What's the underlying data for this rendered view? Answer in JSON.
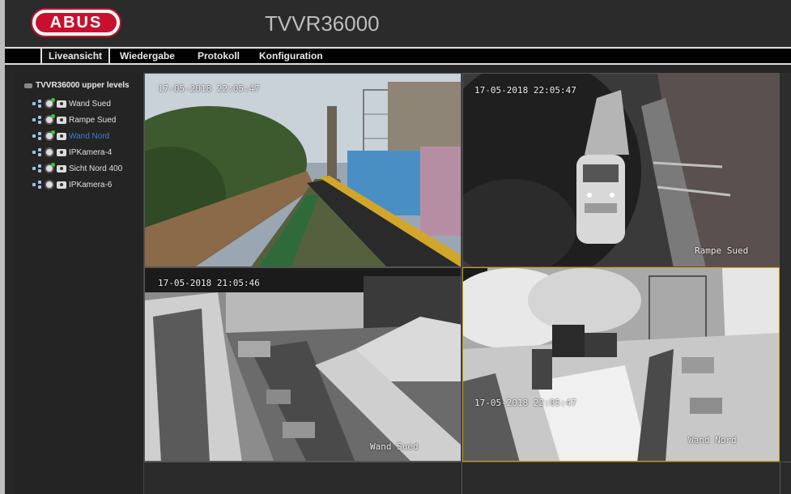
{
  "brand": {
    "logo_text": "ABUS"
  },
  "header": {
    "model": "TVVR36000"
  },
  "nav": {
    "tabs": [
      {
        "label": "Liveansicht",
        "active": true
      },
      {
        "label": "Wiedergabe"
      },
      {
        "label": "Protokoll"
      },
      {
        "label": "Konfiguration"
      }
    ]
  },
  "sidebar": {
    "root_label": "TVVR36000 upper levels",
    "cameras": [
      {
        "label": "Wand Sued",
        "live": true
      },
      {
        "label": "Rampe Sued",
        "live": true
      },
      {
        "label": "Wand Nord",
        "live": true,
        "selected": true
      },
      {
        "label": "IPKamera-4",
        "live": false
      },
      {
        "label": "Sicht Nord 400",
        "live": true
      },
      {
        "label": "IPKamera-6",
        "live": false
      }
    ]
  },
  "views": [
    {
      "timestamp": "17-05-2018 22:05:47",
      "name": ""
    },
    {
      "timestamp": "17-05-2018 22:05:47",
      "name": "Rampe Sued"
    },
    {
      "timestamp": "17-05-2018 21:05:46",
      "name": "Wand Sued"
    },
    {
      "timestamp": "17-05-2018 22:05:47",
      "name": "Wand Nord"
    }
  ],
  "colors": {
    "selected_border": "#d4a017",
    "accent_text": "#3a7fd5",
    "brand_red": "#c8102e"
  }
}
